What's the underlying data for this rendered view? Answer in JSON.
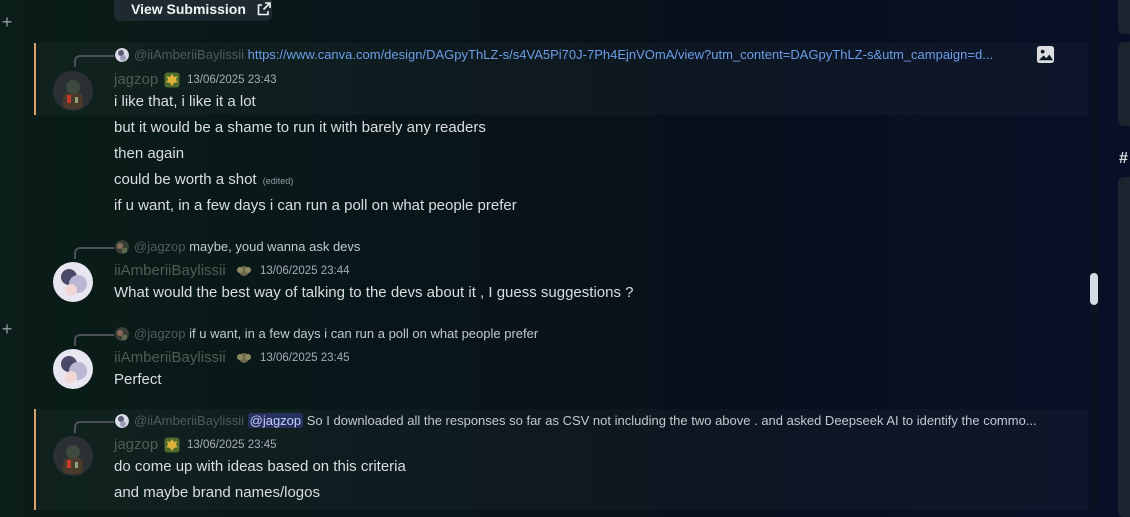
{
  "view_submission": {
    "label": "View Submission",
    "icon": "external-link-icon"
  },
  "messages": [
    {
      "reply": {
        "name": "@iiAmberiiBaylissii",
        "text": "https://www.canva.com/design/DAGpyThLZ-s/s4VA5Pi70J-7Ph4EjnVOmA/view?utm_content=DAGpyThLZ-s&utm_campaign=d...",
        "attachment_icon": "image-icon"
      },
      "author": "jagzop",
      "timestamp": "13/06/2025 23:43",
      "lines": [
        "i like that, i like it a lot",
        "but it would be a shame to run it with barely any readers",
        "then again",
        "could be worth a shot",
        "if u want, in a few days i can run a poll on what people prefer"
      ],
      "edited_label": "(edited)"
    },
    {
      "reply": {
        "name": "@jagzop",
        "text": "maybe, youd wanna ask devs"
      },
      "author": "iiAmberiiBaylissii",
      "timestamp": "13/06/2025 23:44",
      "lines": [
        "What would the best way of talking to the devs about it , I guess suggestions ?"
      ]
    },
    {
      "reply": {
        "name": "@jagzop",
        "text": "if u want, in a few days i can run a poll on what people prefer"
      },
      "author": "iiAmberiiBaylissii",
      "timestamp": "13/06/2025 23:45",
      "lines": [
        "Perfect"
      ]
    },
    {
      "reply": {
        "name": "@iiAmberiiBaylissii",
        "mention": "@jagzop",
        "text": "So I downloaded all the responses so far as CSV not including the two above . and asked Deepseek AI to identify the commo..."
      },
      "author": "jagzop",
      "timestamp": "13/06/2025 23:45",
      "lines": [
        "do come up with ideas based on this criteria",
        "and maybe brand names/logos"
      ]
    }
  ],
  "sidebar": {
    "channel_glyph": "#"
  },
  "colors": {
    "highlight_border": "#d8a36a",
    "link": "#6d9ee8",
    "username": "#4f5d52"
  }
}
